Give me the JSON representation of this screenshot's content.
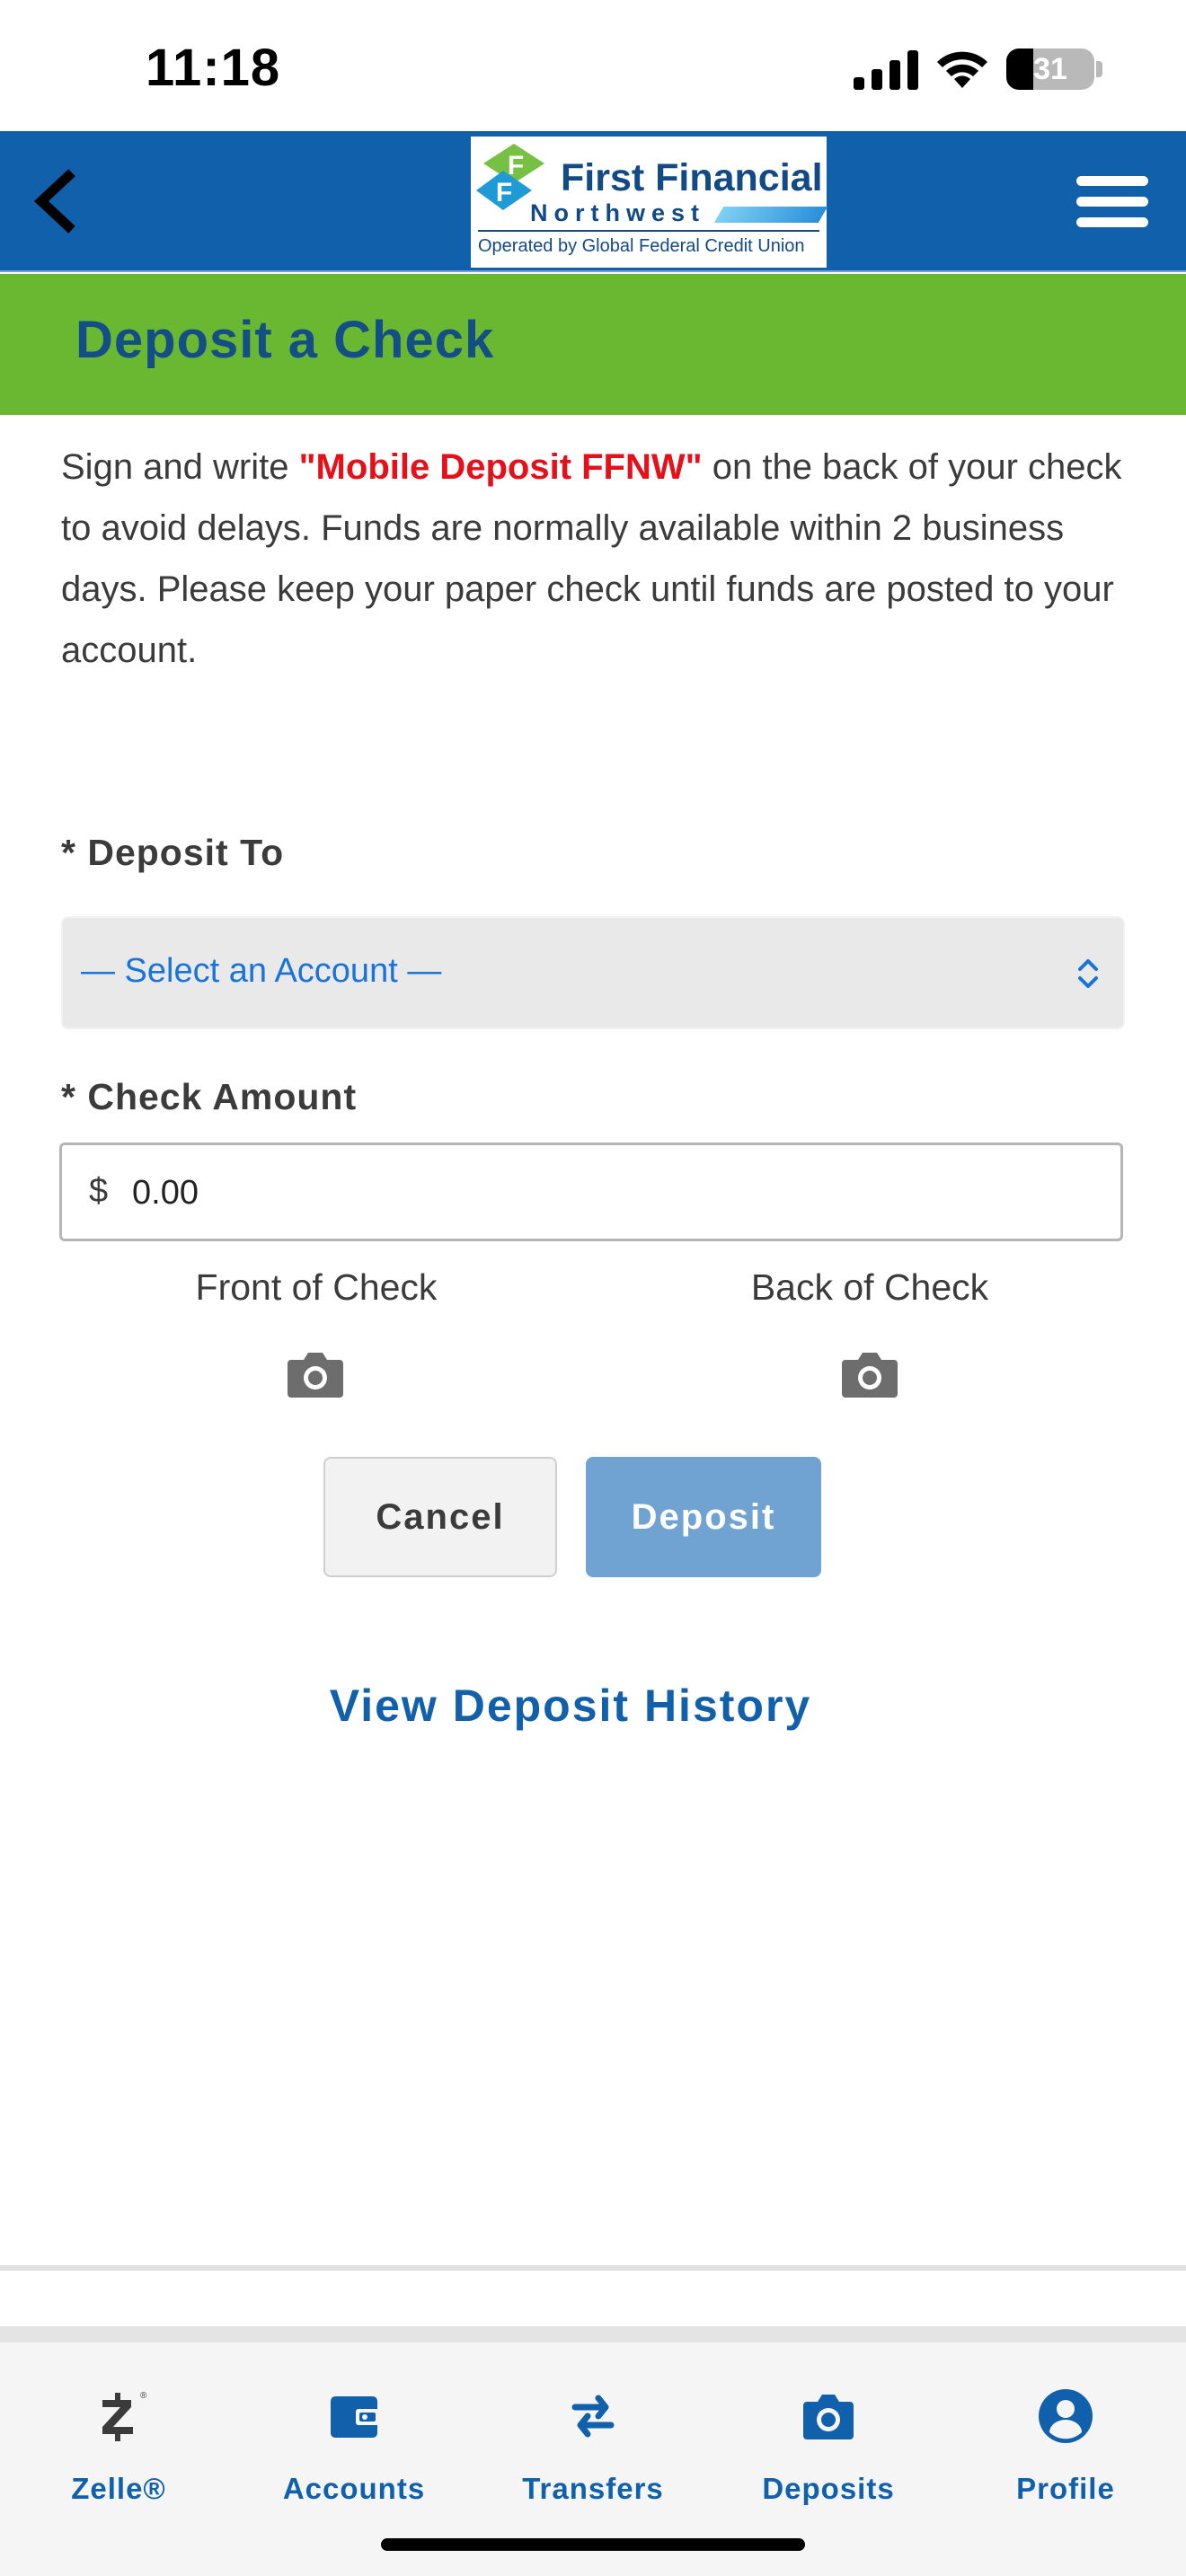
{
  "status_bar": {
    "time": "11:18",
    "battery_level": "31"
  },
  "header": {
    "back_icon": "chevron-left-icon",
    "menu_icon": "hamburger-menu-icon",
    "logo": {
      "name": "First Financial",
      "sub": "Northwest",
      "tagline": "Operated by Global Federal Credit Union"
    },
    "bar_color": "#1160ac"
  },
  "page": {
    "title": "Deposit a Check",
    "title_band_color": "#6ab732",
    "instructions": {
      "before": "Sign and write ",
      "highlight": "\"Mobile Deposit FFNW\"",
      "after": " on the back of your check to avoid delays. Funds are normally available within 2 business days. Please keep your paper check until funds are posted to your account."
    }
  },
  "form": {
    "deposit_to_label": "* Deposit To",
    "account_select_value": "— Select an Account —",
    "check_amount_label": "* Check Amount",
    "amount_prefix": "$",
    "amount_value": "0.00",
    "front_label": "Front of Check",
    "back_label": "Back of Check",
    "camera_icon": "camera-icon"
  },
  "buttons": {
    "cancel": "Cancel",
    "deposit": "Deposit",
    "deposit_color": "#70a2d2"
  },
  "links": {
    "history": "View Deposit History"
  },
  "tab_bar": {
    "items": [
      {
        "label": "Zelle®",
        "icon": "zelle-icon"
      },
      {
        "label": "Accounts",
        "icon": "wallet-icon"
      },
      {
        "label": "Transfers",
        "icon": "transfer-arrows-icon"
      },
      {
        "label": "Deposits",
        "icon": "camera-icon"
      },
      {
        "label": "Profile",
        "icon": "profile-icon"
      }
    ],
    "active_color": "#1160ac"
  }
}
